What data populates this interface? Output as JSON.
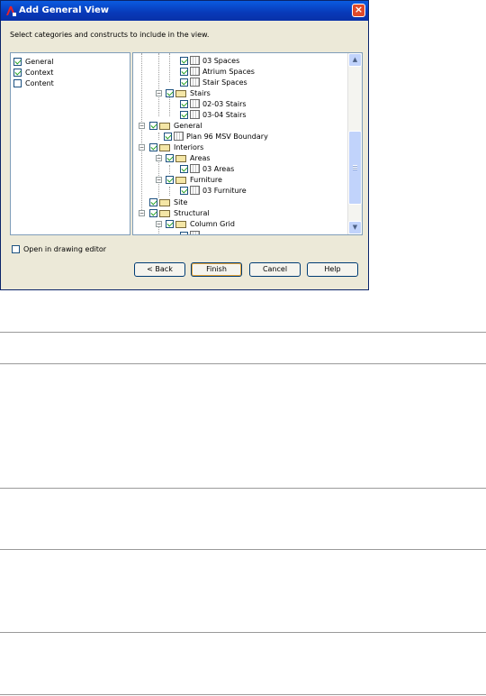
{
  "dialog": {
    "title": "Add General View",
    "instruction": "Select categories and constructs to include in the view."
  },
  "categories": [
    {
      "label": "General",
      "checked": true
    },
    {
      "label": "Context",
      "checked": true
    },
    {
      "label": "Content",
      "checked": false
    }
  ],
  "tree": [
    {
      "label": "03 Spaces",
      "type": "file",
      "checked": true
    },
    {
      "label": "Atrium Spaces",
      "type": "file",
      "checked": true
    },
    {
      "label": "Stair Spaces",
      "type": "file",
      "checked": true
    },
    {
      "label": "Stairs",
      "type": "folder",
      "checked": true
    },
    {
      "label": "02-03 Stairs",
      "type": "file",
      "checked": true
    },
    {
      "label": "03-04 Stairs",
      "type": "file",
      "checked": true
    },
    {
      "label": "General",
      "type": "folder",
      "checked": true
    },
    {
      "label": "Plan 96 MSV Boundary",
      "type": "file",
      "checked": true
    },
    {
      "label": "Interiors",
      "type": "folder",
      "checked": true
    },
    {
      "label": "Areas",
      "type": "folder",
      "checked": true
    },
    {
      "label": "03 Areas",
      "type": "file",
      "checked": true
    },
    {
      "label": "Furniture",
      "type": "folder",
      "checked": true
    },
    {
      "label": "03 Furniture",
      "type": "file",
      "checked": true
    },
    {
      "label": "Site",
      "type": "folder",
      "checked": true
    },
    {
      "label": "Structural",
      "type": "folder",
      "checked": true
    },
    {
      "label": "Column Grid",
      "type": "folder",
      "checked": true
    }
  ],
  "open_in_editor": {
    "label": "Open in drawing editor",
    "checked": false
  },
  "buttons": {
    "back": "< Back",
    "finish": "Finish",
    "cancel": "Cancel",
    "help": "Help"
  },
  "icons": {
    "close": "×",
    "scroll_up": "▲",
    "scroll_down": "▼",
    "expand": "−"
  },
  "colors": {
    "titlebar": "#0a5be0",
    "dialog_bg": "#ece9d8",
    "check": "#21a121",
    "close": "#e04a2a"
  }
}
